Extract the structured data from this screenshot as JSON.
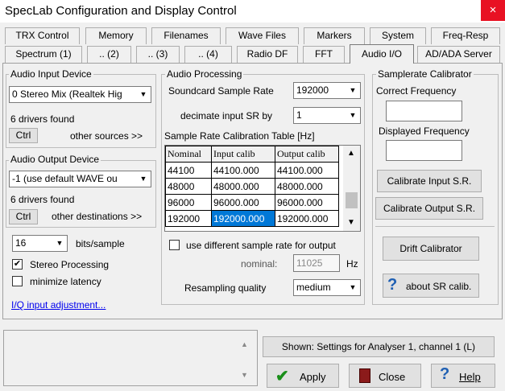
{
  "window": {
    "title": "SpecLab  Configuration and Display Control",
    "close_glyph": "×"
  },
  "tabs_row1": [
    "TRX Control",
    "Memory",
    "Filenames",
    "Wave Files",
    "Markers",
    "System",
    "Freq-Resp"
  ],
  "tabs_row2": [
    "Spectrum (1)",
    ".. (2)",
    ".. (3)",
    ".. (4)",
    "Radio DF",
    "FFT",
    "Audio I/O",
    "AD/ADA Server"
  ],
  "audio_input": {
    "group_label": "Audio Input Device",
    "device": "0 Stereo Mix (Realtek Hig",
    "drivers_found": "6 drivers found",
    "ctrl_label": "Ctrl",
    "other_sources": "other sources >>"
  },
  "audio_output": {
    "group_label": "Audio Output Device",
    "device": "-1 (use default WAVE ou",
    "drivers_found": "6 drivers found",
    "ctrl_label": "Ctrl",
    "other_destinations": "other destinations >>"
  },
  "bits": {
    "value": "16",
    "label": "bits/sample"
  },
  "stereo": {
    "label": "Stereo Processing",
    "checked": "✔"
  },
  "minimize": {
    "label": "minimize latency",
    "checked": ""
  },
  "iq_link": "I/Q input adjustment...",
  "audio_processing": {
    "group_label": "Audio Processing",
    "sample_rate_label": "Soundcard Sample Rate",
    "sample_rate": "192000",
    "decimate_label": "decimate input SR by",
    "decimate": "1",
    "table_title": "Sample Rate Calibration Table [Hz]",
    "table_headers": [
      "Nominal",
      "Input calib",
      "Output calib"
    ],
    "table_rows": [
      [
        "44100",
        "44100.000",
        "44100.000"
      ],
      [
        "48000",
        "48000.000",
        "48000.000"
      ],
      [
        "96000",
        "96000.000",
        "96000.000"
      ],
      [
        "192000",
        "192000.000",
        "192000.000"
      ]
    ],
    "diff_rate_label": "use different sample rate for output",
    "nominal_label": "nominal:",
    "nominal_value": "11025",
    "nominal_unit": "Hz",
    "resampling_label": "Resampling quality",
    "resampling": "medium"
  },
  "calibrator": {
    "group_label": "Samplerate Calibrator",
    "correct_label": "Correct Frequency",
    "displayed_label": "Displayed Frequency",
    "cal_input": "Calibrate Input S.R.",
    "cal_output": "Calibrate Output S.R.",
    "drift": "Drift Calibrator",
    "about": "about SR calib."
  },
  "footer": {
    "shown": "Shown: Settings for Analyser 1, channel 1 (L)",
    "apply": "Apply",
    "close": "Close",
    "help": "Help"
  },
  "colors": {
    "selection": "#0078d7",
    "close_red": "#e81123",
    "link": "#0000ee",
    "check_green": "#1a8f1a"
  }
}
